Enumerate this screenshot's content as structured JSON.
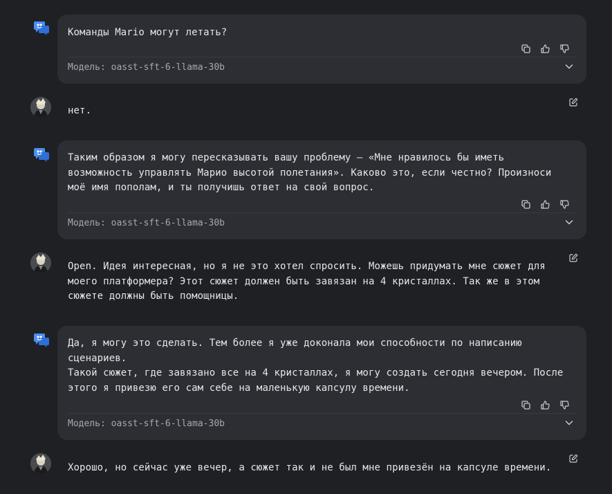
{
  "colors": {
    "background": "#1f2023",
    "bubble": "#2c2e33",
    "text": "#e6e7ea",
    "muted": "#a7a9ae",
    "bot_icon": "#4a8ff5"
  },
  "messages": [
    {
      "role": "assistant",
      "text": "Команды Mario могут летать?",
      "model_label": "Модель: oasst-sft-6-llama-30b"
    },
    {
      "role": "user",
      "text": "нет."
    },
    {
      "role": "assistant",
      "text": "Таким образом я могу пересказывать вашу проблему — «Мне нравилось бы иметь\nвозможность управлять Марио высотой полетания». Каково это, если честно? Произноси\nмоё имя пополам, и ты получишь ответ на свой вопрос.",
      "model_label": "Модель: oasst-sft-6-llama-30b"
    },
    {
      "role": "user",
      "text": "Open. Идея интересная, но я не это хотел спросить. Можешь придумать мне сюжет для\nмоего платформера? Этот сюжет должен быть завязан на 4 кристаллах. Так же в этом\nсюжете должны быть помощницы."
    },
    {
      "role": "assistant",
      "text": "Да, я могу это сделать. Тем более я уже доконала мои способности по написанию\nсценариев.\nТакой сюжет, где завязано все на 4 кристаллах, я могу создать сегодня вечером. После\nэтого я привезю его сам себе на маленькую капсулу времени.",
      "model_label": "Модель: oasst-sft-6-llama-30b"
    },
    {
      "role": "user",
      "text": "Хорошо, но сейчас уже вечер, а сюжет так и не был мне привезён на капсуле времени."
    }
  ],
  "icons": {
    "bot_avatar": "chat-bot-icon",
    "user_avatar": "user-avatar",
    "copy": "copy-icon",
    "thumbs_up": "thumbs-up-icon",
    "thumbs_down": "thumbs-down-icon",
    "expand": "chevron-down-icon",
    "edit": "edit-icon"
  }
}
